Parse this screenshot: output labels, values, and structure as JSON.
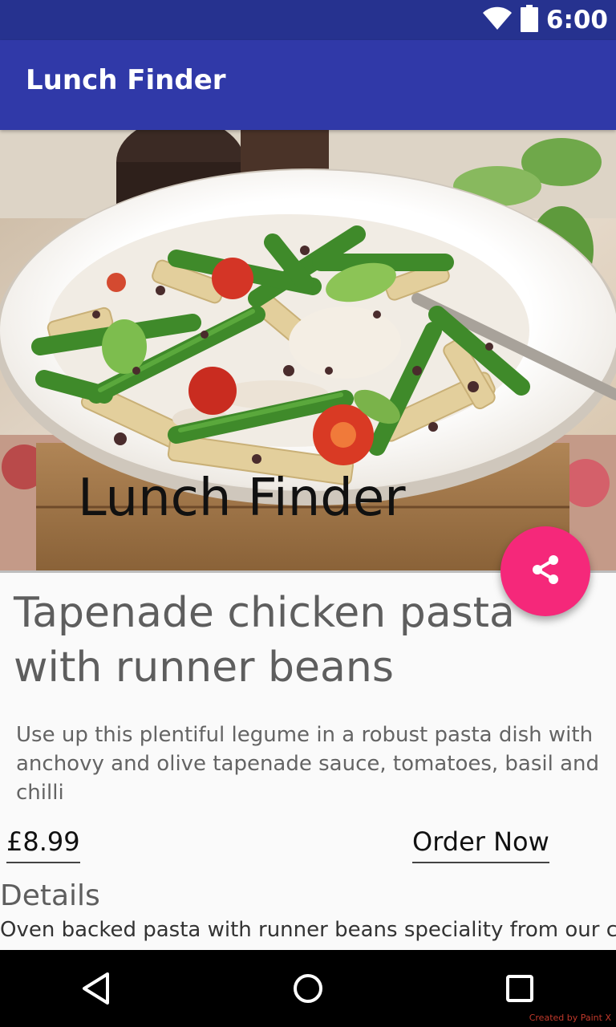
{
  "status_bar": {
    "time": "6:00",
    "icons": [
      "wifi-icon",
      "battery-icon"
    ]
  },
  "app_bar": {
    "title": "Lunch Finder"
  },
  "hero": {
    "overlay_title": "Lunch Finder"
  },
  "fab": {
    "icon": "share-icon",
    "color": "#f5287a"
  },
  "recipe": {
    "title": "Tapenade chicken pasta with runner beans",
    "description": "Use up this plentiful legume in a robust pasta dish with anchovy and olive tapenade sauce, tomatoes, basil and chilli",
    "price": "£8.99",
    "order_label": "Order Now",
    "details_heading": "Details",
    "details_text": "Oven backed pasta with runner beans speciality from our chef"
  },
  "nav_bar": {
    "buttons": [
      "back-icon",
      "home-icon",
      "recents-icon"
    ]
  },
  "watermark": "Created by Paint X",
  "colors": {
    "status_bar": "#26328f",
    "app_bar": "#3039a8",
    "accent": "#f5287a",
    "background": "#fafafa"
  }
}
